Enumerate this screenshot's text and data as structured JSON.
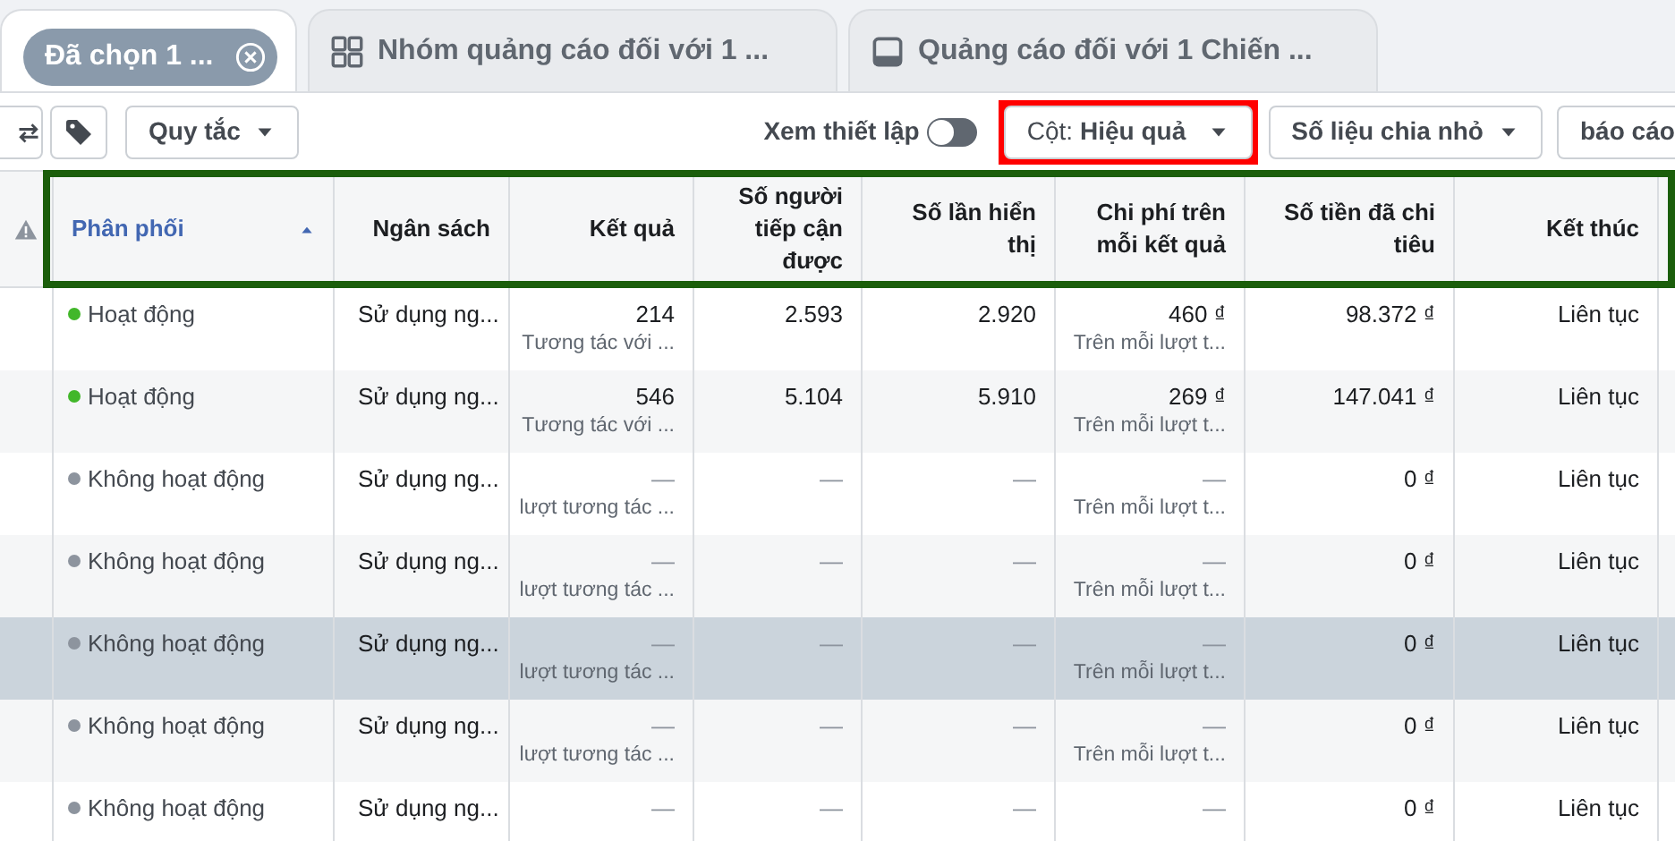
{
  "tabs": [
    {
      "label": "Đã chọn 1 ...",
      "kind": "chip",
      "selected": true
    },
    {
      "label": "Nhóm quảng cáo đối với 1 ...",
      "kind": "grid",
      "selected": false
    },
    {
      "label": "Quảng cáo đối với 1 Chiến ...",
      "kind": "ad",
      "selected": false
    }
  ],
  "toolbar": {
    "rules_button": "Quy tắc",
    "view_setup": {
      "label": "Xem thiết lập",
      "on": false
    },
    "columns_button": {
      "label": "Cột:",
      "value": "Hiệu quả",
      "highlighted": true
    },
    "breakdown_button": "Số liệu chia nhỏ",
    "reports_button": "báo cáo"
  },
  "table": {
    "header_outlined": true,
    "columns": [
      {
        "label": "Phân phối",
        "sorted": true
      },
      {
        "label": "Ngân sách",
        "sorted": false
      },
      {
        "label": "Kết quả",
        "sorted": false
      },
      {
        "label": "Số người tiếp cận được",
        "sorted": false
      },
      {
        "label": "Số lần hiển thị",
        "sorted": false
      },
      {
        "label": "Chi phí trên mỗi kết quả",
        "sorted": false
      },
      {
        "label": "Số tiền đã chi tiêu",
        "sorted": false
      },
      {
        "label": "Kết thúc",
        "sorted": false
      }
    ],
    "rows": [
      {
        "selected": false,
        "status": "Hoạt động",
        "color": "#42b72a",
        "budget": "Sử dụng ng...",
        "results": "214",
        "results_sub": "Tương tác với ...",
        "reach": "2.593",
        "impressions": "2.920",
        "cost": "460 ₫",
        "cost_sub": "Trên mỗi lượt t...",
        "spent": "98.372 ₫",
        "end": "Liên tục"
      },
      {
        "selected": false,
        "status": "Hoạt động",
        "color": "#42b72a",
        "budget": "Sử dụng ng...",
        "results": "546",
        "results_sub": "Tương tác với ...",
        "reach": "5.104",
        "impressions": "5.910",
        "cost": "269 ₫",
        "cost_sub": "Trên mỗi lượt t...",
        "spent": "147.041 ₫",
        "end": "Liên tục"
      },
      {
        "selected": false,
        "status": "Không hoạt động",
        "color": "#8d949e",
        "budget": "Sử dụng ng...",
        "results": "—",
        "results_sub": "lượt tương tác ...",
        "reach": "—",
        "impressions": "—",
        "cost": "—",
        "cost_sub": "Trên mỗi lượt t...",
        "spent": "0 ₫",
        "end": "Liên tục"
      },
      {
        "selected": false,
        "status": "Không hoạt động",
        "color": "#8d949e",
        "budget": "Sử dụng ng...",
        "results": "—",
        "results_sub": "lượt tương tác ...",
        "reach": "—",
        "impressions": "—",
        "cost": "—",
        "cost_sub": "Trên mỗi lượt t...",
        "spent": "0 ₫",
        "end": "Liên tục"
      },
      {
        "selected": true,
        "status": "Không hoạt động",
        "color": "#8d949e",
        "budget": "Sử dụng ng...",
        "results": "—",
        "results_sub": "lượt tương tác ...",
        "reach": "—",
        "impressions": "—",
        "cost": "—",
        "cost_sub": "Trên mỗi lượt t...",
        "spent": "0 ₫",
        "end": "Liên tục"
      },
      {
        "selected": false,
        "status": "Không hoạt động",
        "color": "#8d949e",
        "budget": "Sử dụng ng...",
        "results": "—",
        "results_sub": "lượt tương tác ...",
        "reach": "—",
        "impressions": "—",
        "cost": "—",
        "cost_sub": "Trên mỗi lượt t...",
        "spent": "0 ₫",
        "end": "Liên tục"
      },
      {
        "selected": false,
        "status": "Không hoạt động",
        "color": "#8d949e",
        "budget": "Sử dụng ng...",
        "results": "—",
        "reach": "—",
        "impressions": "—",
        "cost": "—",
        "spent": "0 ₫",
        "end": "Liên tục"
      }
    ]
  }
}
